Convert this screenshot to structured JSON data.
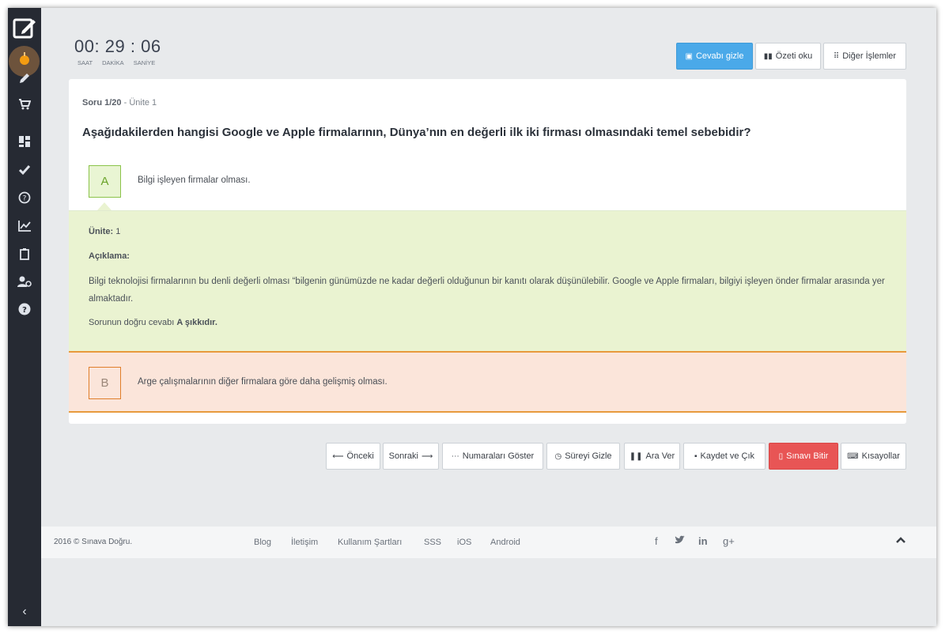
{
  "timer": {
    "hours": "00",
    "minutes": "29",
    "seconds": "06",
    "sep": ":",
    "label_hours": "SAAT",
    "label_minutes": "DAKİKA",
    "label_seconds": "SANİYE"
  },
  "top_actions": {
    "hide_answer": "Cevabı gizle",
    "read_summary": "Özeti oku",
    "other_actions": "Diğer İşlemler"
  },
  "question": {
    "number": "Soru 1/20",
    "unit": "- Ünite 1",
    "text": "Aşağıdakilerden hangisi Google ve Apple firmalarının, Dünya’nın en değerli ilk iki firması olmasındaki temel sebebidir?"
  },
  "options": {
    "a": {
      "letter": "A",
      "text": "Bilgi işleyen firmalar olması."
    },
    "b": {
      "letter": "B",
      "text": "Arge çalışmalarının diğer firmalara göre daha gelişmiş olması."
    }
  },
  "explanation": {
    "unit_label": "Ünite:",
    "unit_value": "1",
    "title": "Açıklama:",
    "body": "Bilgi teknolojisi firmalarının bu denli değerli olması “bilgenin günümüzde ne kadar değerli olduğunun bir kanıtı olarak düşünülebilir. Google ve Apple firmaları, bilgiyi işleyen önder firmalar arasında yer almaktadır.",
    "answer_prefix": "Sorunun doğru cevabı",
    "answer_bold": "A şıkkıdır."
  },
  "bottom_actions": {
    "prev": "Önceki",
    "next": "Sonraki",
    "show_numbers": "Numaraları Göster",
    "hide_time": "Süreyi Gizle",
    "pause": "Ara Ver",
    "save_exit": "Kaydet ve Çık",
    "finish": "Sınavı Bitir",
    "shortcuts": "Kısayollar"
  },
  "footer": {
    "copyright": "2016 © Sınava Doğru.",
    "links": [
      "Blog",
      "İletişim",
      "Kullanım Şartları",
      "SSS",
      "iOS",
      "Android"
    ],
    "social": [
      "f",
      "t",
      "in",
      "g+"
    ]
  },
  "colors": {
    "sidebar": "#262a33",
    "primary_blue": "#4aa9e9",
    "danger_red": "#e85555",
    "correct_green_bg": "#eaf3d1",
    "wrong_orange_bg": "#fbe5da",
    "accent_orange": "#e89a3c"
  },
  "icons": {
    "logo": "edit-square-icon",
    "sidebar": [
      "pencil-icon",
      "cart-icon",
      "dashboard-icon",
      "check-icon",
      "question-circle-icon",
      "chart-icon",
      "clipboard-icon",
      "user-settings-icon",
      "help-icon"
    ],
    "collapse": "chevron-left-icon"
  }
}
